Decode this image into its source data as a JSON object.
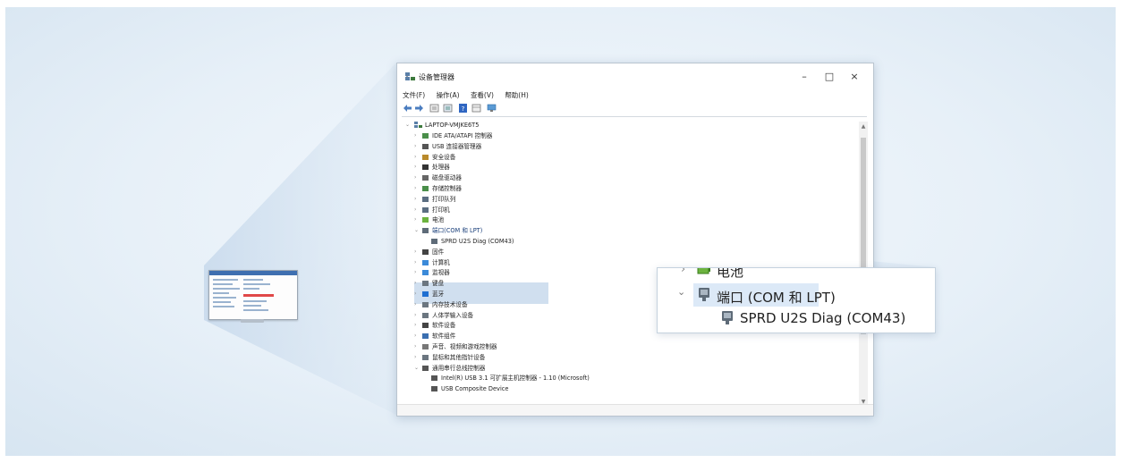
{
  "window": {
    "title": "设备管理器",
    "controls": {
      "minimize": "–",
      "maximize": "□",
      "close": "×"
    }
  },
  "menu": [
    "文件(F)",
    "操作(A)",
    "查看(V)",
    "帮助(H)"
  ],
  "toolbar_icons": [
    "back-arrow-icon",
    "forward-arrow-icon",
    "properties-icon",
    "show-hide-icon",
    "help-icon",
    "view-icon",
    "monitor-icon"
  ],
  "tree": {
    "root": "LAPTOP-VMJKE6T5",
    "items": [
      {
        "label": "IDE ATA/ATAPI 控制器",
        "icon": "ide-controller-icon",
        "expanded": false
      },
      {
        "label": "USB 连接器管理器",
        "icon": "usb-icon",
        "expanded": false
      },
      {
        "label": "安全设备",
        "icon": "security-device-icon",
        "expanded": false
      },
      {
        "label": "处理器",
        "icon": "processor-icon",
        "expanded": false
      },
      {
        "label": "磁盘驱动器",
        "icon": "disk-drive-icon",
        "expanded": false
      },
      {
        "label": "存储控制器",
        "icon": "storage-controller-icon",
        "expanded": false
      },
      {
        "label": "打印队列",
        "icon": "print-queue-icon",
        "expanded": false
      },
      {
        "label": "打印机",
        "icon": "printer-icon",
        "expanded": false
      },
      {
        "label": "电池",
        "icon": "battery-icon",
        "expanded": false
      },
      {
        "label": "端口(COM 和 LPT)",
        "icon": "port-icon",
        "expanded": true,
        "selected": true
      },
      {
        "label": "SPRD U2S Diag (COM43)",
        "icon": "port-device-icon",
        "child": true
      },
      {
        "label": "固件",
        "icon": "firmware-icon",
        "expanded": false
      },
      {
        "label": "计算机",
        "icon": "computer-icon",
        "expanded": false
      },
      {
        "label": "监视器",
        "icon": "monitor-icon",
        "expanded": false
      },
      {
        "label": "键盘",
        "icon": "keyboard-icon",
        "expanded": false
      },
      {
        "label": "蓝牙",
        "icon": "bluetooth-icon",
        "expanded": false
      },
      {
        "label": "内存技术设备",
        "icon": "memory-device-icon",
        "expanded": false
      },
      {
        "label": "人体学输入设备",
        "icon": "hid-icon",
        "expanded": false
      },
      {
        "label": "软件设备",
        "icon": "software-device-icon",
        "expanded": false
      },
      {
        "label": "软件组件",
        "icon": "software-component-icon",
        "expanded": false
      },
      {
        "label": "声音、视频和游戏控制器",
        "icon": "sound-icon",
        "expanded": false
      },
      {
        "label": "鼠标和其他指针设备",
        "icon": "mouse-icon",
        "expanded": false
      },
      {
        "label": "通用串行总线控制器",
        "icon": "usb-controller-icon",
        "expanded": true
      },
      {
        "label": "Intel(R) USB 3.1 可扩展主机控制器 - 1.10 (Microsoft)",
        "icon": "usb-device-icon",
        "child": true
      },
      {
        "label": "USB Composite Device",
        "icon": "usb-device-icon",
        "child": true
      }
    ]
  },
  "callout": {
    "battery_label": "电池",
    "port_label": "端口 (COM 和 LPT)",
    "device_label": "SPRD U2S Diag (COM43)"
  },
  "colors": {
    "accent": "#3f6fb0",
    "selection": "#aac4e1",
    "background": "#e7f0f8"
  }
}
